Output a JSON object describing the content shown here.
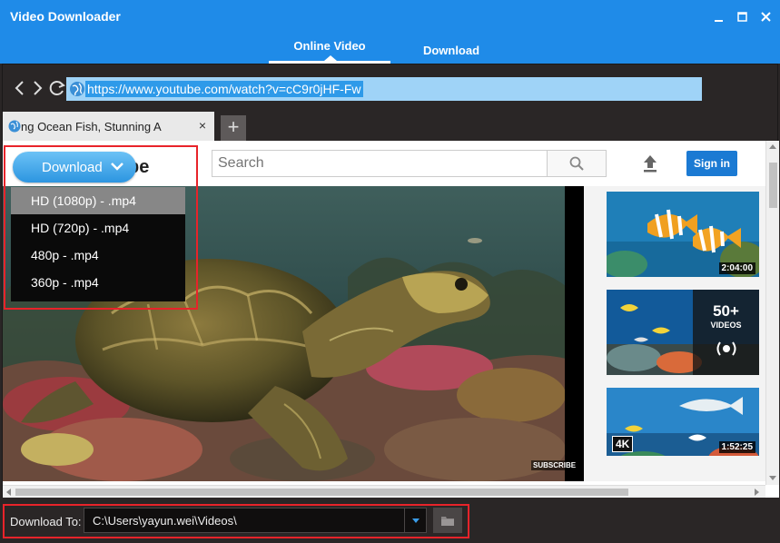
{
  "app": {
    "title": "Video Downloader"
  },
  "main_tabs": [
    {
      "label": "Online Video",
      "active": true
    },
    {
      "label": "Download",
      "active": false
    }
  ],
  "browser": {
    "url": "https://www.youtube.com/watch?v=cC9r0jHF-Fw",
    "tab_title": "...ng Ocean Fish, Stunning Aquarium",
    "tab_title_visible": "ng Ocean Fish, Stunning A",
    "new_tab": "+",
    "close_tab": "×"
  },
  "youtube": {
    "logo_text": "be",
    "search_placeholder": "Search",
    "signin_label": "Sign in",
    "subscribe_badge": "SUBSCRIBE",
    "sidebar": [
      {
        "duration": "2:04:00"
      },
      {
        "playlist_count": "50+",
        "playlist_label": "VIDEOS"
      },
      {
        "badge": "4K",
        "duration": "1:52:25"
      }
    ]
  },
  "download_menu": {
    "button_label": "Download",
    "options": [
      {
        "label": "HD (1080p) - .mp4",
        "selected": true
      },
      {
        "label": "HD (720p) - .mp4",
        "selected": false
      },
      {
        "label": "480p - .mp4",
        "selected": false
      },
      {
        "label": "360p - .mp4",
        "selected": false
      }
    ]
  },
  "footer": {
    "download_to_label": "Download To:",
    "path": "C:\\Users\\yayun.wei\\Videos\\"
  },
  "colors": {
    "titlebar": "#1f8be8",
    "highlight": "#e8232a",
    "signin": "#1b7ad3",
    "dark_bg": "#2a2626"
  }
}
